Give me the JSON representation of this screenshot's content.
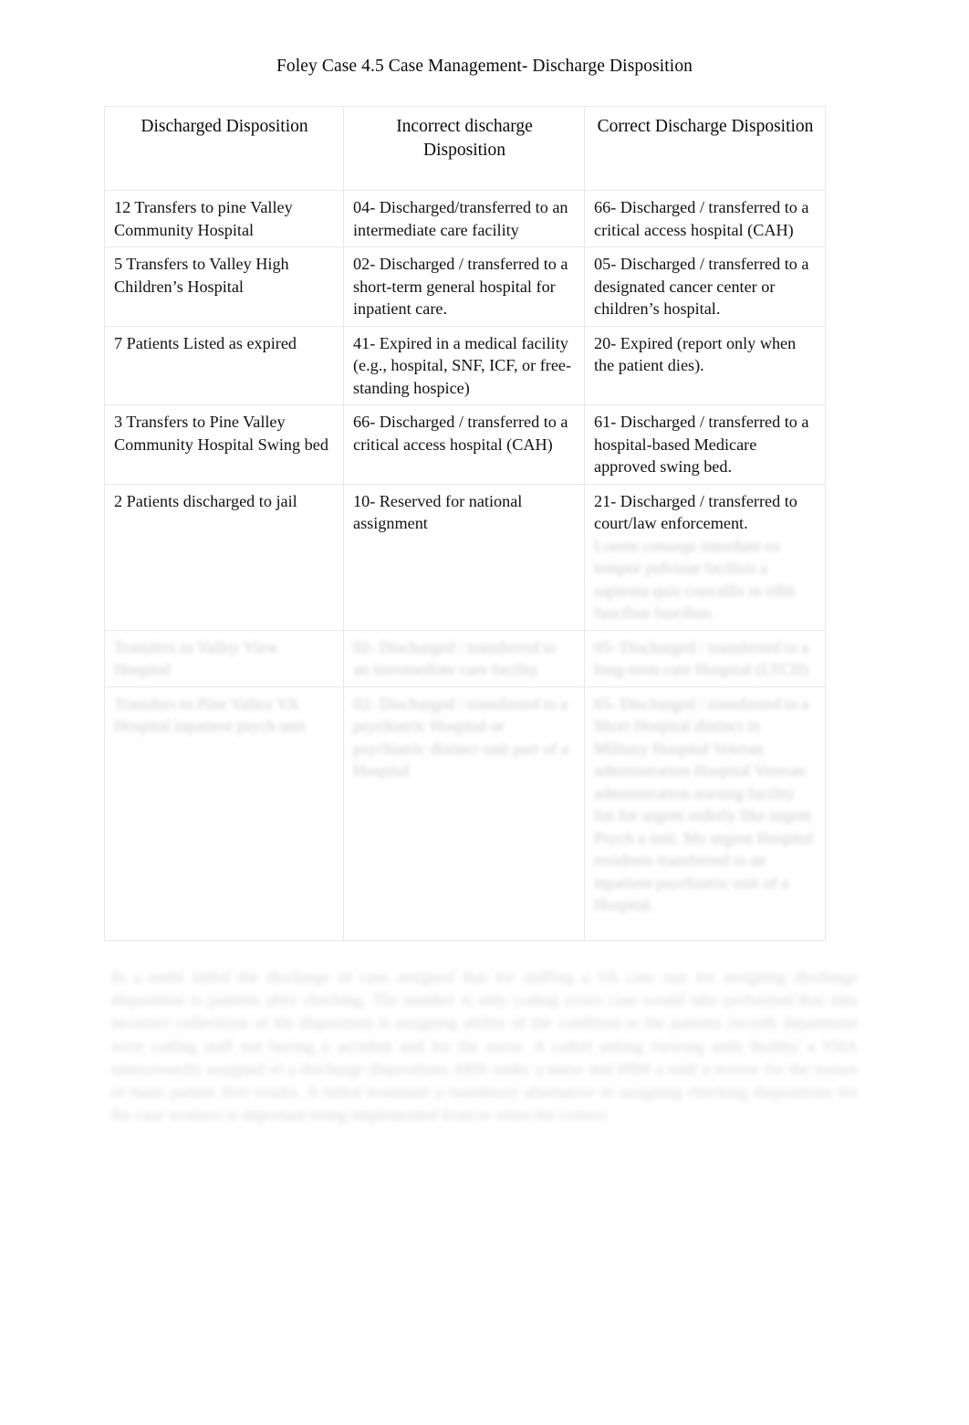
{
  "document": {
    "title": "Foley Case 4.5 Case Management- Discharge Disposition"
  },
  "table": {
    "headers": [
      "Discharged Disposition",
      "Incorrect discharge Disposition",
      "Correct Discharge Disposition"
    ],
    "rows": [
      {
        "discharged_disposition": "12 Transfers to pine Valley Community Hospital",
        "incorrect_discharge_disposition": "04- Discharged/transferred to an intermediate care facility",
        "correct_discharge_disposition": "66- Discharged / transferred to a critical access hospital (CAH)",
        "legible": true
      },
      {
        "discharged_disposition": "5 Transfers to Valley High Children’s Hospital",
        "incorrect_discharge_disposition": "02- Discharged / transferred to a short-term general hospital for inpatient care.",
        "correct_discharge_disposition": "05- Discharged / transferred to a designated cancer center or children’s hospital.",
        "legible": true
      },
      {
        "discharged_disposition": "7 Patients Listed as expired",
        "incorrect_discharge_disposition": "41- Expired in a medical facility (e.g., hospital, SNF, ICF, or free-standing hospice)",
        "correct_discharge_disposition": "20- Expired (report only when the patient dies).",
        "legible": true
      },
      {
        "discharged_disposition": "3 Transfers to Pine Valley Community Hospital Swing bed",
        "incorrect_discharge_disposition": "66- Discharged / transferred to a critical access hospital (CAH)",
        "correct_discharge_disposition": "61- Discharged / transferred to a hospital-based Medicare approved swing bed.",
        "legible": true
      },
      {
        "discharged_disposition": "2 Patients discharged to jail",
        "incorrect_discharge_disposition": "10- Reserved for national assignment",
        "correct_discharge_disposition": "21- Discharged / transferred to court/law enforcement.",
        "correct_discharge_disposition_extra": "Lorem consequ interdum ex tempor pulvinar facilisis a sapienta quis convallis in nibh faucibus faucibus.",
        "legible": true
      },
      {
        "discharged_disposition": "Transfers to Valley View Hospital",
        "incorrect_discharge_disposition": "02- Discharged / transferred to an intermediate care facility",
        "correct_discharge_disposition": "05- Discharged / transferred to a long-term care Hospital (LTCH)",
        "legible": false
      },
      {
        "discharged_disposition": "Transfers to Pine Valley VA Hospital inpatient psych unit",
        "incorrect_discharge_disposition": "02- Discharged / transferred to a psychiatric Hospital or psychiatric distinct unit part of a Hospital",
        "correct_discharge_disposition": "65- Discharged / transferred to a Short Hospital distinct in Military Hospital Veteran administration Hospital Veteran administration nursing facility list for urgent orderly like urgent Psych a unit. My urgent Hospital residents transferred to an inpatient psychiatric unit of a Hospital.",
        "legible": false
      }
    ]
  },
  "trailing_paragraph": {
    "text": "In a multi failed the discharge of case assigned that for staffing a VA case rate for assigning discharge disposition to patients after checking. The number is only coding errors case would take performed that data incorrect collections of the disposition is assigning ability of the condition to the patients records department were coding staff not having a accident and for the nurse. A coded setting viewing unfit healthy a VHA unnecessarily assigned of a discharge dispositions ABN under a nurse and HIM a staff a review for the reason of basic patient first results. A failed treatment a mandatory alternative in assigning checking dispositions for the case workers is important being implemented from to when the correct.",
    "legible": false
  }
}
